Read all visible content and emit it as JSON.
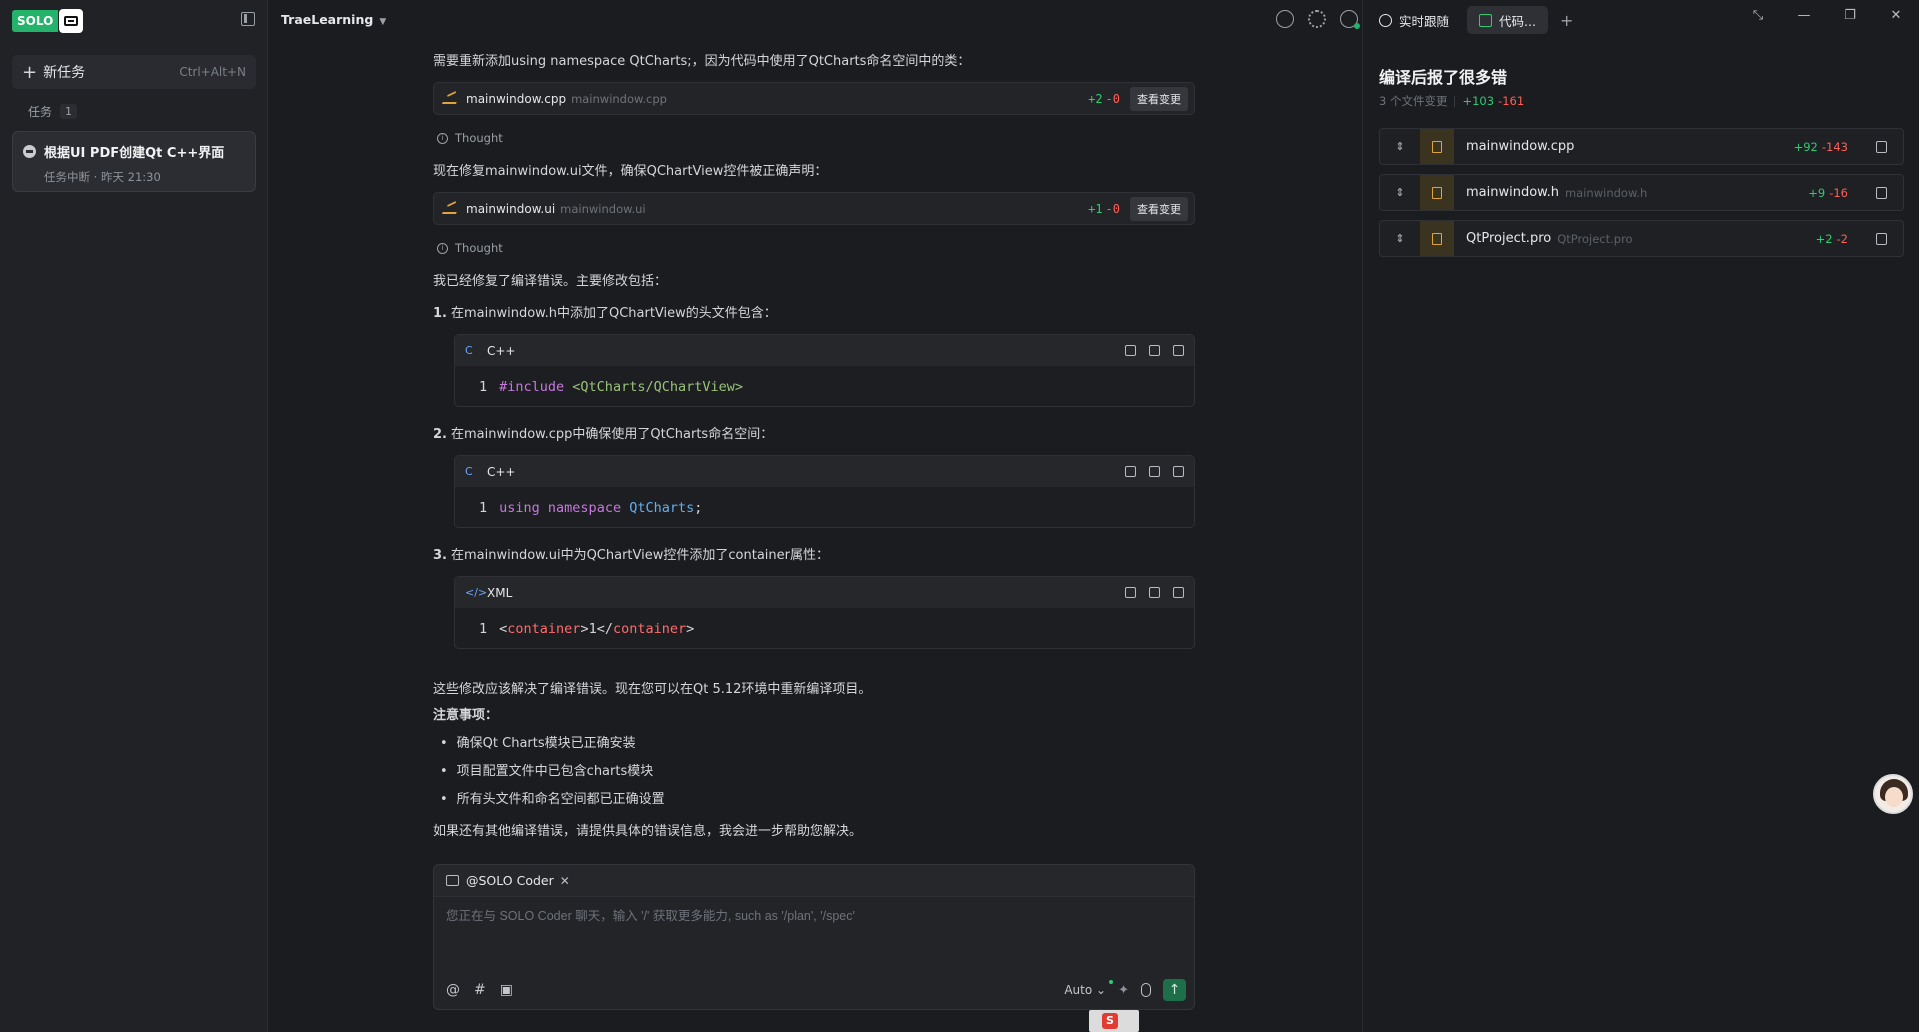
{
  "sidebar": {
    "logo_text": "SOLO",
    "new_task_label": "新任务",
    "new_task_shortcut": "Ctrl+Alt+N",
    "tasks_label": "任务",
    "tasks_count": "1",
    "task": {
      "title": "根据UI PDF创建Qt C++界面",
      "status": "任务中断 · 昨天 21:30"
    }
  },
  "topbar": {
    "project": "TraeLearning"
  },
  "chat": {
    "line1": "需要重新添加using namespace QtCharts;，因为代码中使用了QtCharts命名空间中的类：",
    "change1": {
      "file": "mainwindow.cpp",
      "path": "mainwindow.cpp",
      "add": "+2",
      "del": "-0",
      "btn": "查看变更"
    },
    "thought_label": "Thought",
    "line2": "现在修复mainwindow.ui文件，确保QChartView控件被正确声明：",
    "change2": {
      "file": "mainwindow.ui",
      "path": "mainwindow.ui",
      "add": "+1",
      "del": "-0",
      "btn": "查看变更"
    },
    "line3": "我已经修复了编译错误。主要修改包括：",
    "items": [
      {
        "num": "1.",
        "text": "在mainwindow.h中添加了QChartView的头文件包含：",
        "lang": "C++",
        "ln": "1",
        "code": {
          "a": "#include",
          "b": " <QtCharts/QChartView>"
        }
      },
      {
        "num": "2.",
        "text": "在mainwindow.cpp中确保使用了QtCharts命名空间：",
        "lang": "C++",
        "ln": "1",
        "code": {
          "a": "using",
          "b": "namespace",
          "c": "QtCharts",
          "d": ";"
        }
      },
      {
        "num": "3.",
        "text": "在mainwindow.ui中为QChartView控件添加了container属性：",
        "lang": "XML",
        "ln": "1",
        "code": {
          "lt": "<",
          "tag": "container",
          "gt": ">",
          "val": "1",
          "lt2": "</",
          "tag2": "container",
          "gt2": ">"
        }
      }
    ],
    "line4": "这些修改应该解决了编译错误。现在您可以在Qt 5.12环境中重新编译项目。",
    "note_title": "注意事项：",
    "bullets": [
      "确保Qt Charts模块已正确安装",
      "项目配置文件中已包含charts模块",
      "所有头文件和命名空间都已正确设置"
    ],
    "line5": "如果还有其他编译错误，请提供具体的错误信息，我会进一步帮助您解决。"
  },
  "composer": {
    "agent": "@SOLO Coder",
    "placeholder": "您正在与 SOLO Coder 聊天，输入 '/' 获取更多能力, such as '/plan', '/spec'",
    "mode": "Auto"
  },
  "right": {
    "tab_follow": "实时跟随",
    "tab_code": "代码...",
    "title": "编译后报了很多错",
    "files_changed": "3 个文件变更",
    "total_add": "+103",
    "total_del": "-161",
    "files": [
      {
        "name": "mainwindow.cpp",
        "path": "",
        "add": "+92",
        "del": "-143"
      },
      {
        "name": "mainwindow.h",
        "path": "mainwindow.h",
        "add": "+9",
        "del": "-16"
      },
      {
        "name": "QtProject.pro",
        "path": "QtProject.pro",
        "add": "+2",
        "del": "-2"
      }
    ]
  },
  "ime": {
    "label": "S"
  }
}
